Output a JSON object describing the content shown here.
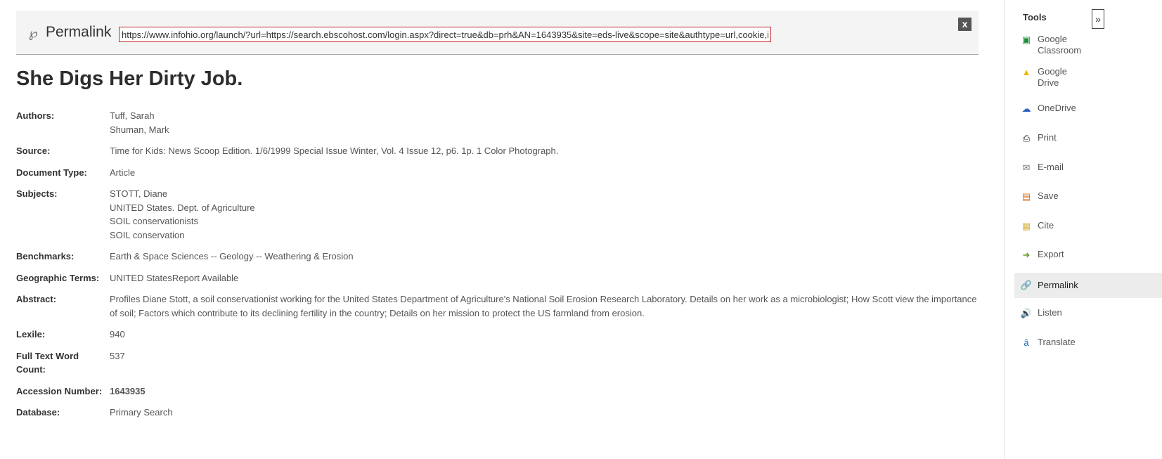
{
  "permalink": {
    "label": "Permalink",
    "url": "https://www.infohio.org/launch/?url=https://search.ebscohost.com/login.aspx?direct=true&db=prh&AN=1643935&site=eds-live&scope=site&authtype=url,cookie,ip,c",
    "close": "x"
  },
  "title": "She Digs Her Dirty Job.",
  "fields": [
    {
      "key": "Authors:",
      "values": [
        "Tuff, Sarah",
        "Shuman, Mark"
      ]
    },
    {
      "key": "Source:",
      "values": [
        "Time for Kids: News Scoop Edition. 1/6/1999 Special Issue Winter, Vol. 4 Issue 12, p6. 1p. 1 Color Photograph."
      ]
    },
    {
      "key": "Document Type:",
      "values": [
        "Article"
      ]
    },
    {
      "key": "Subjects:",
      "values": [
        "STOTT, Diane",
        "UNITED States. Dept. of Agriculture",
        "SOIL conservationists",
        "SOIL conservation"
      ]
    },
    {
      "key": "Benchmarks:",
      "values": [
        "Earth & Space Sciences -- Geology -- Weathering & Erosion"
      ]
    },
    {
      "key": "Geographic Terms:",
      "values": [
        "UNITED StatesReport Available"
      ]
    },
    {
      "key": "Abstract:",
      "values": [
        "Profiles Diane Stott, a soil conservationist working for the United States Department of Agriculture's National Soil Erosion Research Laboratory. Details on her work as a microbiologist; How Scott view the importance of soil; Factors which contribute to its declining fertility in the country; Details on her mission to protect the US farmland from erosion."
      ]
    },
    {
      "key": "Lexile:",
      "values": [
        "940"
      ]
    },
    {
      "key": "Full Text Word Count:",
      "values": [
        "537"
      ]
    },
    {
      "key": "Accession Number:",
      "values": [
        "1643935"
      ]
    },
    {
      "key": "Database:",
      "values": [
        "Primary Search"
      ]
    }
  ],
  "tools": {
    "title": "Tools",
    "collapse": "»",
    "items": [
      {
        "label": "Google Classroom",
        "icon": "google-classroom-icon",
        "glyph": "▣",
        "color": "#1e8e3e"
      },
      {
        "label": "Google Drive",
        "icon": "google-drive-icon",
        "glyph": "▲",
        "color": "#f4b400"
      },
      {
        "label": "OneDrive",
        "icon": "onedrive-icon",
        "glyph": "☁",
        "color": "#2b63c6"
      },
      {
        "label": "Print",
        "icon": "printer-icon",
        "glyph": "⎙",
        "color": "#333"
      },
      {
        "label": "E-mail",
        "icon": "email-icon",
        "glyph": "✉",
        "color": "#777"
      },
      {
        "label": "Save",
        "icon": "save-icon",
        "glyph": "▤",
        "color": "#e0701a"
      },
      {
        "label": "Cite",
        "icon": "cite-icon",
        "glyph": "▦",
        "color": "#d8b84a"
      },
      {
        "label": "Export",
        "icon": "export-icon",
        "glyph": "➜",
        "color": "#6a9a2a"
      },
      {
        "label": "Permalink",
        "icon": "link-icon",
        "glyph": "🔗",
        "color": "#555"
      },
      {
        "label": "Listen",
        "icon": "speaker-icon",
        "glyph": "🔊",
        "color": "#3a7ad0"
      },
      {
        "label": "Translate",
        "icon": "translate-icon",
        "glyph": "â",
        "color": "#1f6ab8"
      }
    ]
  }
}
